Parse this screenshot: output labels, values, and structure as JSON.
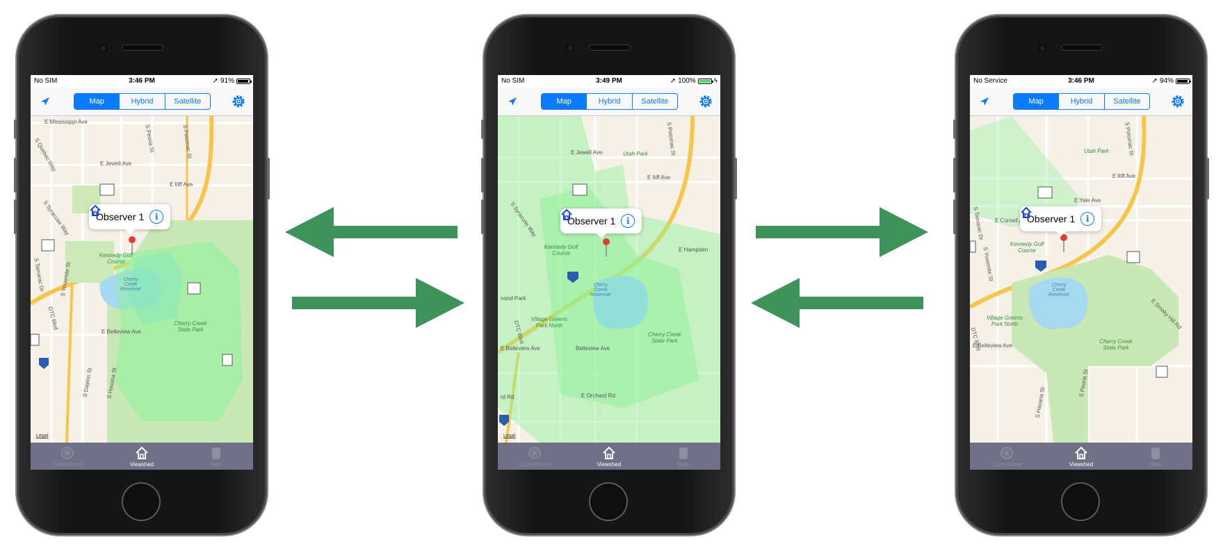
{
  "colors": {
    "accent": "#0a7bff",
    "arrow": "#3e935a",
    "viewshed": "#8ef29a",
    "tabbar": "#707087"
  },
  "phones": [
    {
      "carrier": "No SIM",
      "time": "3:46 PM",
      "battery": "91%",
      "battery_level": 0.91,
      "charging": false,
      "segments": [
        "Map",
        "Hybrid",
        "Satellite"
      ],
      "selected_segment": "Map",
      "callout": "Observer 1",
      "labels": {
        "l1": "E Mississippi Ave",
        "l2": "S Quebec Way",
        "l3": "E Jewell Ave",
        "l4": "E Iliff Ave",
        "l5": "S Syracuse Way",
        "l6": "S Tamarac Dr",
        "l7": "S Yosemite St",
        "l8": "DTC Blvd",
        "l9": "E Belleview Ave",
        "l10": "S Dayton St",
        "l11": "S Havana St",
        "l12": "Kennedy Golf Course",
        "l13": "Cherry Creek Reservoir",
        "l14": "Cherry Creek State Park",
        "l15": "S Peoria St",
        "l16": "S Potomac St"
      },
      "shields": [
        "30",
        "30",
        "83",
        "225",
        "25",
        "83",
        "83"
      ],
      "legal": "Legal"
    },
    {
      "carrier": "No SIM",
      "time": "3:49 PM",
      "battery": "100%",
      "battery_level": 1.0,
      "charging": true,
      "segments": [
        "Map",
        "Hybrid",
        "Satellite"
      ],
      "selected_segment": "Map",
      "callout": "Observer 1",
      "labels": {
        "l1": "E Jewell Ave",
        "l2": "Utah Park",
        "l3": "E Iliff Ave",
        "l4": "S Syracuse Way",
        "l5": "Kennedy Golf Course",
        "l6": "E Hampden",
        "l7": "Cherry Creek Reservoir",
        "l8": "Village Greens Park North",
        "l9": "DTC Blvd",
        "l10": "E Belleview Ave",
        "l11": "Cherry Creek State Park",
        "l12": "E Orchard Rd",
        "l13": "Belleview Ave",
        "l14": "nond Park",
        "l15": "rd Rd",
        "l16": "S Potomac St"
      },
      "shields": [
        "30",
        "225",
        "25"
      ],
      "legal": "Legal"
    },
    {
      "carrier": "No Service",
      "time": "3:46 PM",
      "battery": "94%",
      "battery_level": 0.94,
      "charging": false,
      "segments": [
        "Map",
        "Hybrid",
        "Satellite"
      ],
      "selected_segment": "Map",
      "callout": "Observer 1",
      "labels": {
        "l1": "Utah Park",
        "l2": "E Iliff Ave",
        "l3": "E Yale Ave",
        "l4": "E Cornell Ave",
        "l5": "Kennedy Golf Course",
        "l6": "S Yosemite St",
        "l7": "Cherry Creek Reservoir",
        "l8": "Village Greens Park North",
        "l9": "E Belleview Ave",
        "l10": "DTC Blvd",
        "l11": "Cherry Creek State Park",
        "l12": "E Smoky Hill Rd",
        "l13": "S Havana St",
        "l14": "S Peoria St",
        "l15": "S Potomac St",
        "l16": "S Tamarac Dr"
      },
      "shields": [
        "30",
        "225",
        "83",
        "83"
      ],
      "legal": "Legal"
    }
  ],
  "tabs": [
    {
      "label": "Connections",
      "icon": "connections-icon"
    },
    {
      "label": "Viewshed",
      "icon": "viewshed-icon"
    },
    {
      "label": "Data",
      "icon": "data-icon"
    }
  ],
  "tabs_selected": "Viewshed"
}
